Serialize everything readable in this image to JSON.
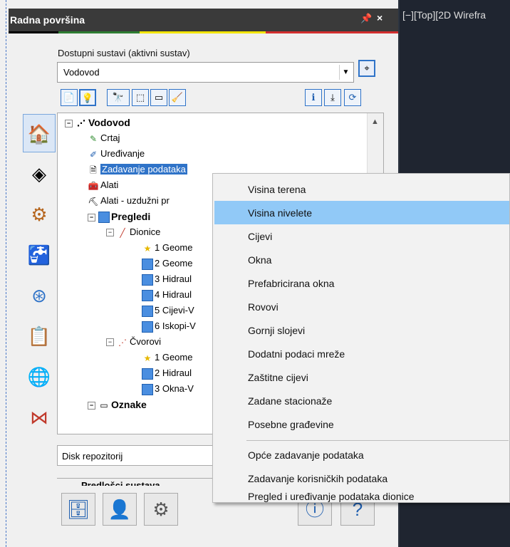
{
  "panel": {
    "title": "Radna površina",
    "pin_icon": "pin-icon",
    "close_glyph": "×",
    "stripe_colors": [
      "#000000",
      "#2e7d32",
      "#f3e500",
      "#f3e500",
      "#d32f2f"
    ]
  },
  "viewport": {
    "label": "[−][Top][2D Wirefra"
  },
  "systems": {
    "label": "Dostupni sustavi (aktivni sustav)",
    "selected": "Vodovod"
  },
  "toolbar_icons": [
    "new-doc-icon",
    "lightbulb-icon",
    "binoculars-abc-icon",
    "select-cursor-icon",
    "window-icon",
    "broom-icon",
    "info-icon",
    "import-icon",
    "refresh-icon"
  ],
  "sidebar_icons": [
    "home-icon",
    "grid-icon",
    "pipe-valve-icon",
    "faucet-icon",
    "network-nodes-icon",
    "user-report-icon",
    "globe-tools-icon",
    "network-lines-icon"
  ],
  "tree": {
    "root": "Vodovod",
    "items": [
      {
        "label": "Crtaj"
      },
      {
        "label": "Uređivanje"
      },
      {
        "label": "Zadavanje podataka"
      },
      {
        "label": "Alati"
      },
      {
        "label": "Alati - uzdužni pr"
      }
    ],
    "pregledi": "Pregledi",
    "dionice": "Dionice",
    "dionice_items": [
      "1 Geome",
      "2 Geome",
      "3 Hidraul",
      "4 Hidraul",
      "5 Cijevi-V",
      "6 Iskopi-V"
    ],
    "cvorovi": "Čvorovi",
    "cvorovi_items": [
      "1 Geome",
      "2 Hidraul",
      "3 Okna-V"
    ],
    "oznake": "Oznake"
  },
  "bottom": {
    "disk": "Disk repozitorij",
    "pdl": "Predlošci sustava",
    "buttons": [
      "database-icon",
      "user-icon",
      "settings-check-icon"
    ],
    "right_buttons": [
      "info-round-icon",
      "help-round-icon"
    ]
  },
  "context_menu": {
    "items": [
      "Visina terena",
      "Visina nivelete",
      "Cijevi",
      "Okna",
      "Prefabricirana okna",
      "Rovovi",
      "Gornji slojevi",
      "Dodatni podaci mreže",
      "Zaštitne cijevi",
      "Zadane stacionaže",
      "Posebne građevine",
      "Opće zadavanje podataka",
      "Zadavanje korisničkih podataka",
      "Pregled i uređivanje podataka dionice"
    ],
    "highlighted": "Visina nivelete",
    "highlight_color": "#91c9f7"
  }
}
